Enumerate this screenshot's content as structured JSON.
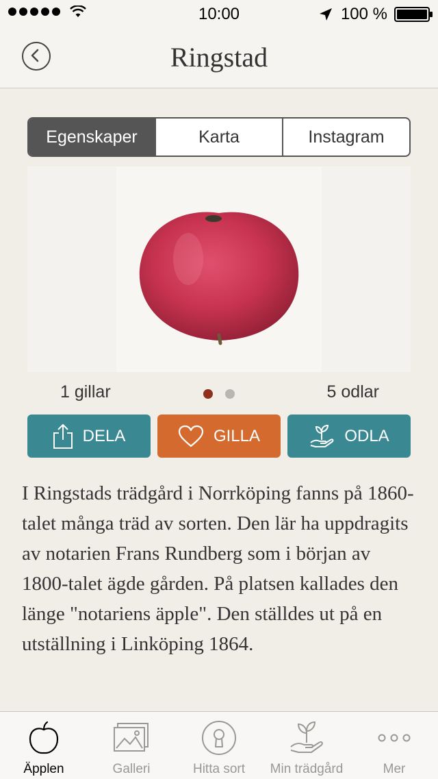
{
  "status_bar": {
    "time": "10:00",
    "battery": "100 %",
    "battery_level": 1.0,
    "signal_dots": 5
  },
  "nav": {
    "title": "Ringstad",
    "back_icon": "chevron-left-icon"
  },
  "segments": [
    {
      "label": "Egenskaper",
      "active": true
    },
    {
      "label": "Karta",
      "active": false
    },
    {
      "label": "Instagram",
      "active": false
    }
  ],
  "counts": {
    "likes": "1 gillar",
    "grow": "5 odlar"
  },
  "pager": {
    "pages": 2,
    "current": 1,
    "active_color": "#8f2f1e",
    "inactive_color": "#b9b6b2"
  },
  "actions": {
    "share": {
      "label": "DELA",
      "icon": "share-icon"
    },
    "like": {
      "label": "GILLA",
      "icon": "heart-icon"
    },
    "grow": {
      "label": "ODLA",
      "icon": "plant-hand-icon"
    }
  },
  "description": "I Ringstads trädgård i Norrköping fanns på 1860-talet många träd av sorten. Den lär ha uppdragits av notarien Frans Rundberg som i början av 1800-talet ägde gården. På platsen kallades den länge \"notariens äpple\". Den ställdes ut på en utställning i Linköping 1864.",
  "tabs": [
    {
      "label": "Äpplen",
      "icon": "apple-icon",
      "active": true
    },
    {
      "label": "Galleri",
      "icon": "gallery-icon",
      "active": false
    },
    {
      "label": "Hitta sort",
      "icon": "keyhole-icon",
      "active": false
    },
    {
      "label": "Min trädgård",
      "icon": "plant-hand-icon",
      "active": false
    },
    {
      "label": "Mer",
      "icon": "more-dots-icon",
      "active": false
    }
  ],
  "colors": {
    "accent_teal": "#3a8992",
    "accent_orange": "#d46a2e",
    "apple_red": "#c7334f"
  }
}
